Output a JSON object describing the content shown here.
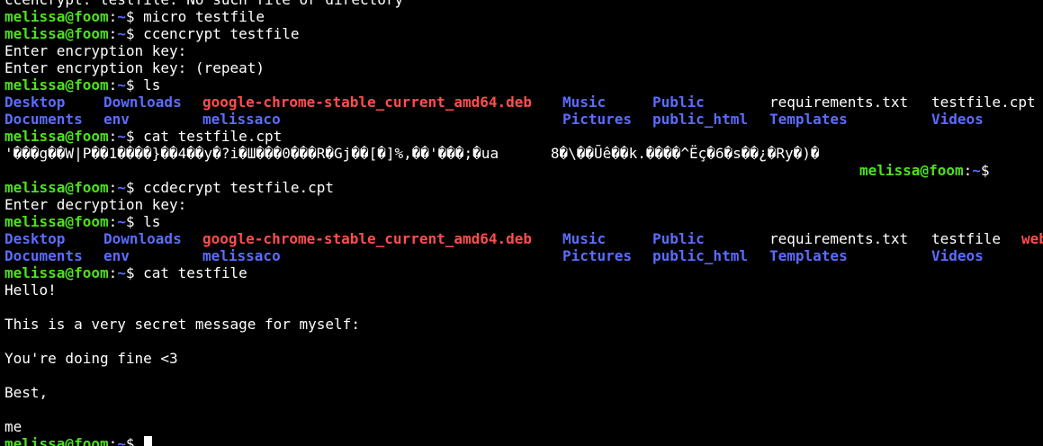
{
  "prompt": {
    "user_host": "melissa@foom",
    "colon": ":",
    "path": "~",
    "symbol": "$ "
  },
  "lines": {
    "l0": "ccencrypt: testfile: No such file or directory",
    "cmd_micro": "micro testfile",
    "cmd_ccencrypt": "ccencrypt testfile",
    "enc_key": "Enter encryption key:",
    "enc_key_repeat": "Enter encryption key: (repeat)",
    "cmd_ls": "ls",
    "cmd_cat_cpt": "cat testfile.cpt",
    "garbage": "'���g��W|P��1����}��4��y�?i�Ш���0���R�Gj��[�]%,��'���;�ua      8�\\��Ũê��k.����^Ëç�6�s��¿�Ry�)�",
    "cmd_ccdecrypt": "ccdecrypt testfile.cpt",
    "dec_key": "Enter decryption key:",
    "cmd_cat": "cat testfile",
    "msg_hello": "Hello!",
    "msg_secret": "This is a very secret message for myself:",
    "msg_fine": "You're doing fine <3",
    "msg_best": "Best,",
    "msg_me": "me"
  },
  "ls1": {
    "row1": [
      "Desktop",
      "Downloads",
      "google-chrome-stable_current_amd64.deb",
      "Music",
      "Public",
      "requirements.txt",
      "testfile.cpt"
    ],
    "row2": [
      "Documents",
      "env",
      "melissaco",
      "Pictures",
      "public_html",
      "Templates",
      "Videos"
    ]
  },
  "ls2": {
    "row1": [
      "Desktop",
      "Downloads",
      "google-chrome-stable_current_amd64.deb",
      "Music",
      "Public",
      "requirements.txt",
      "testfile",
      "web"
    ],
    "row2": [
      "Documents",
      "env",
      "melissaco",
      "Pictures",
      "public_html",
      "Templates",
      "Videos"
    ]
  },
  "colors": {
    "background": "#000000",
    "prompt_user": "#4ee01e",
    "directory": "#5b6cff",
    "deb_package": "#ff4d4d",
    "text": "#ffffff"
  }
}
